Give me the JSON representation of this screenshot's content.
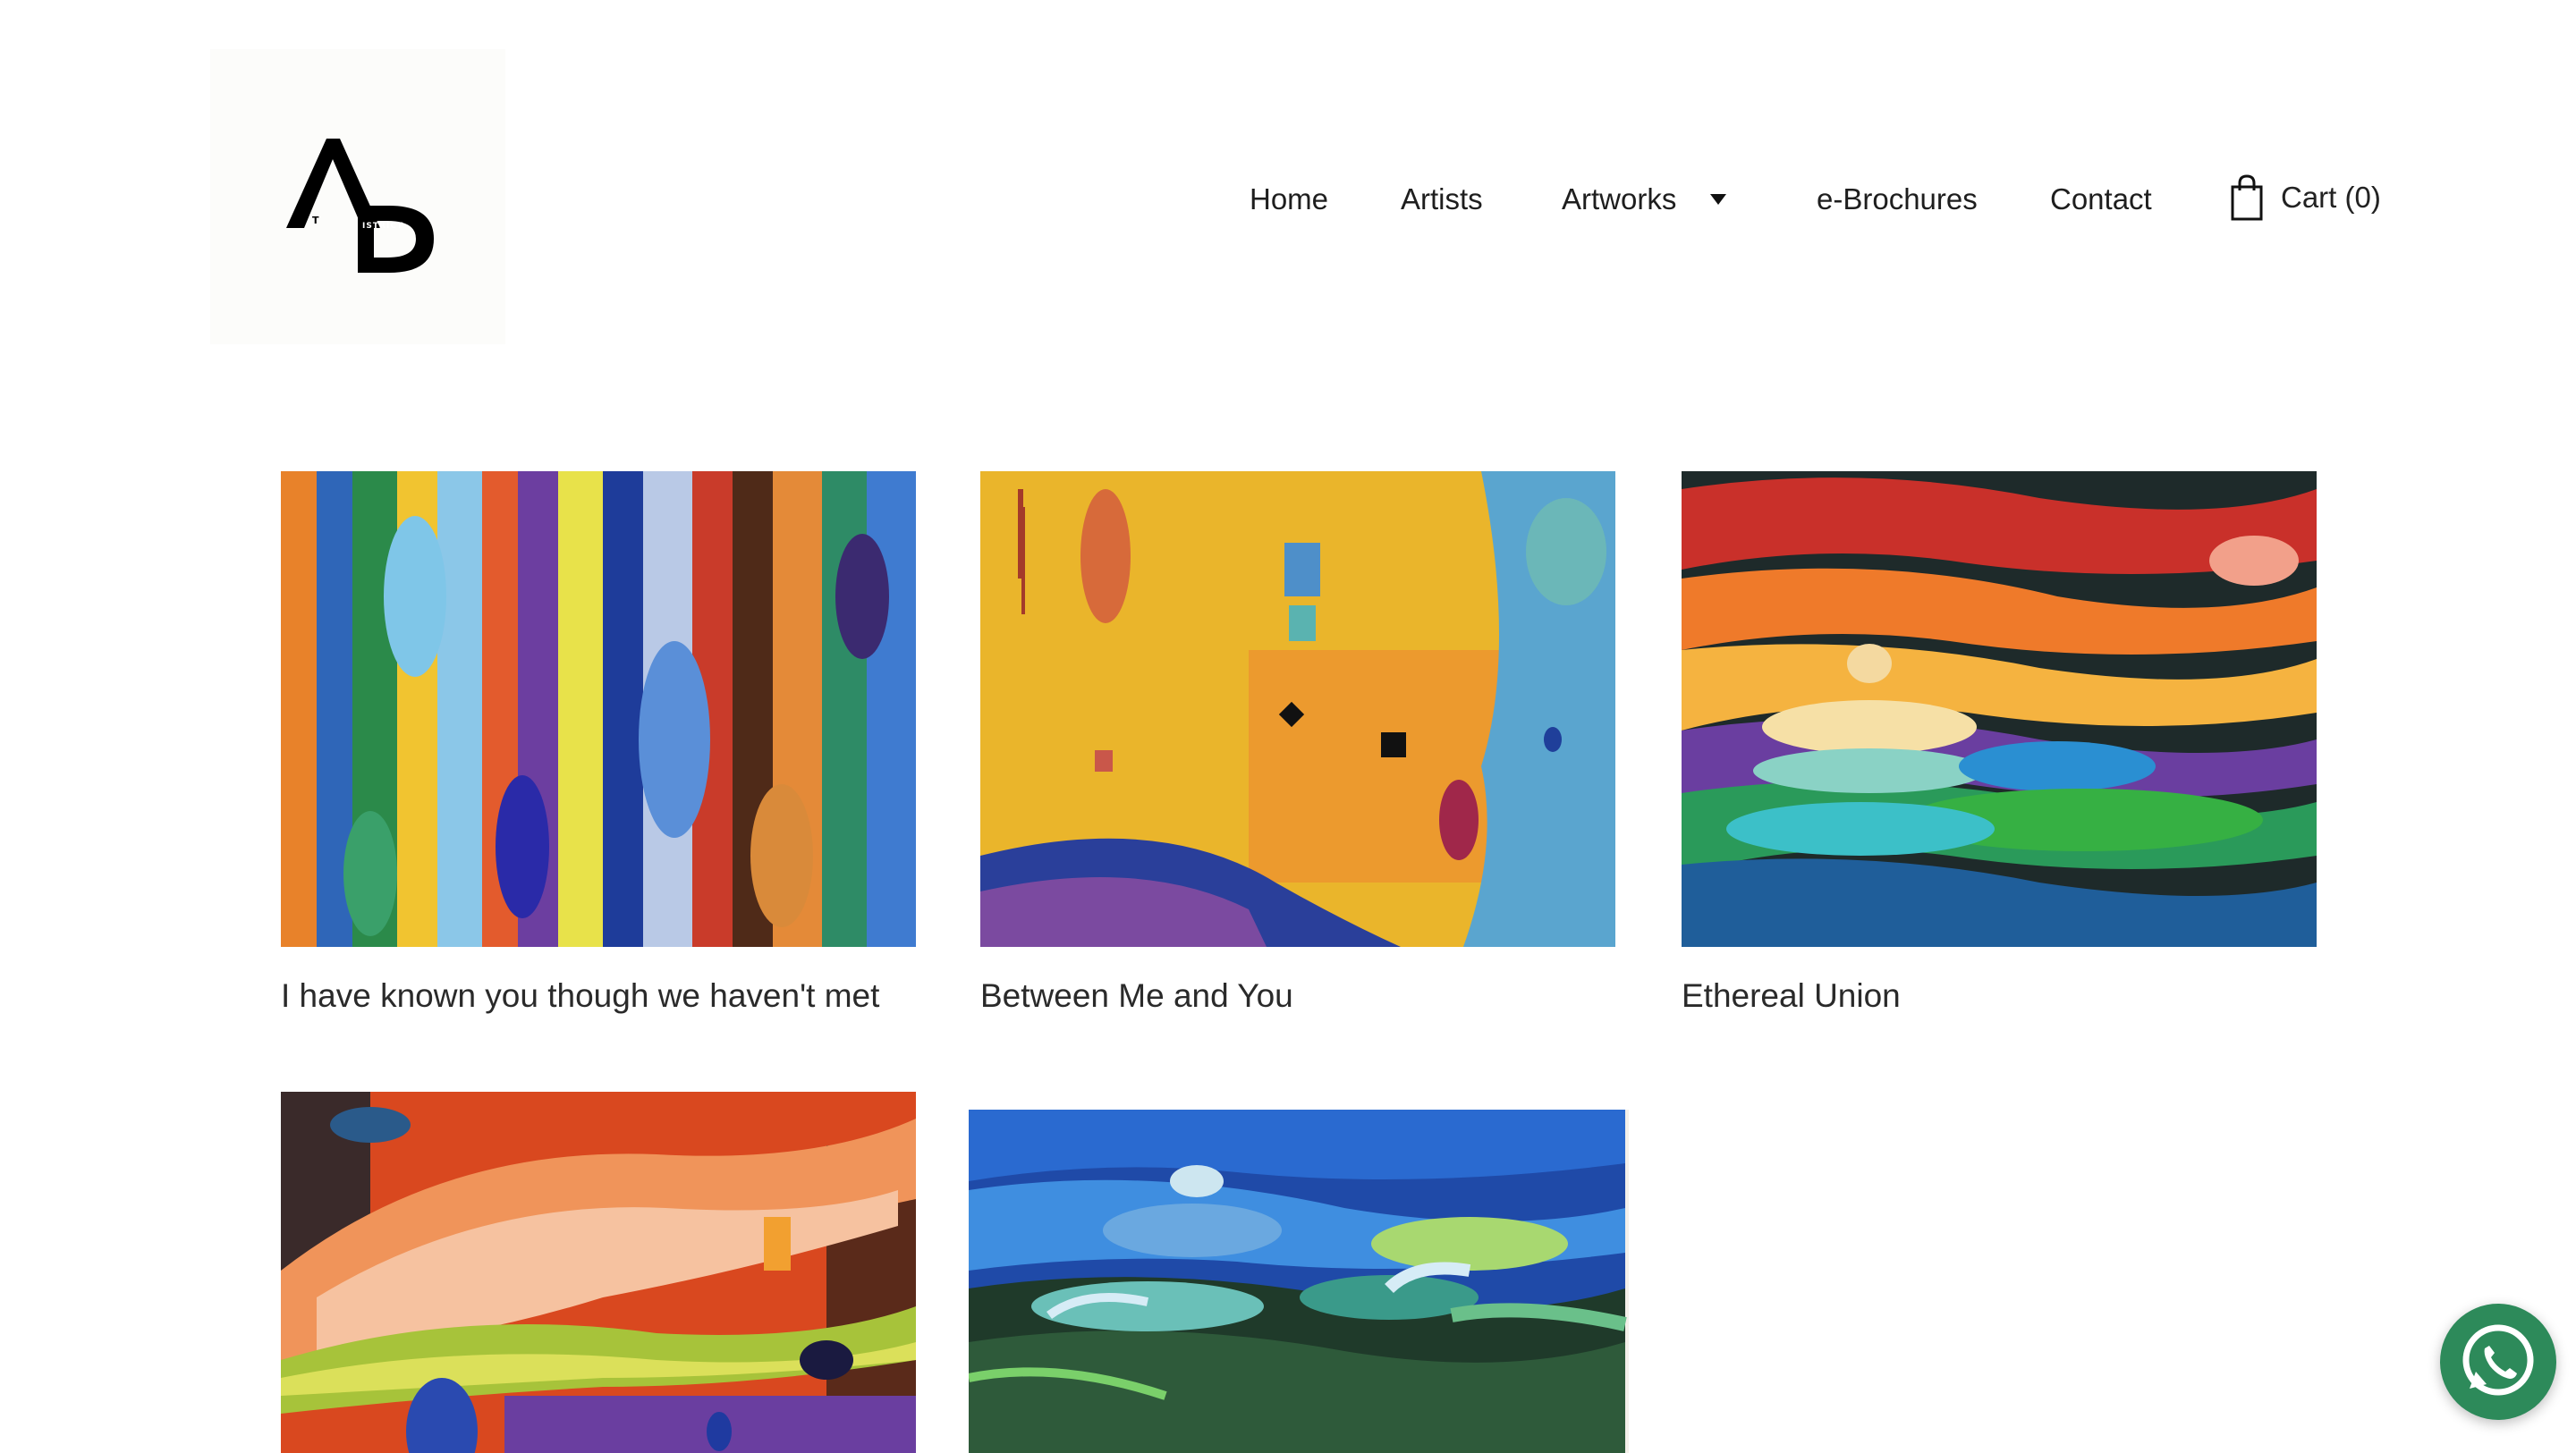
{
  "header": {
    "logo": {
      "letters": "A RT D ISTRICT",
      "icon": "art-district-logo"
    },
    "nav": [
      {
        "label": "Home"
      },
      {
        "label": "Artists"
      },
      {
        "label": "Artworks",
        "has_dropdown": true
      },
      {
        "label": "e-Brochures"
      },
      {
        "label": "Contact"
      }
    ],
    "cart": {
      "label": "Cart (0)",
      "icon": "shopping-bag-icon"
    }
  },
  "gallery": {
    "items": [
      {
        "title": "I have known you though we haven't met"
      },
      {
        "title": "Between Me and You"
      },
      {
        "title": "Ethereal Union"
      },
      {
        "title": ""
      },
      {
        "title": ""
      }
    ]
  },
  "floating": {
    "whatsapp_icon": "whatsapp-icon",
    "whatsapp_color": "#2d8a5a"
  }
}
